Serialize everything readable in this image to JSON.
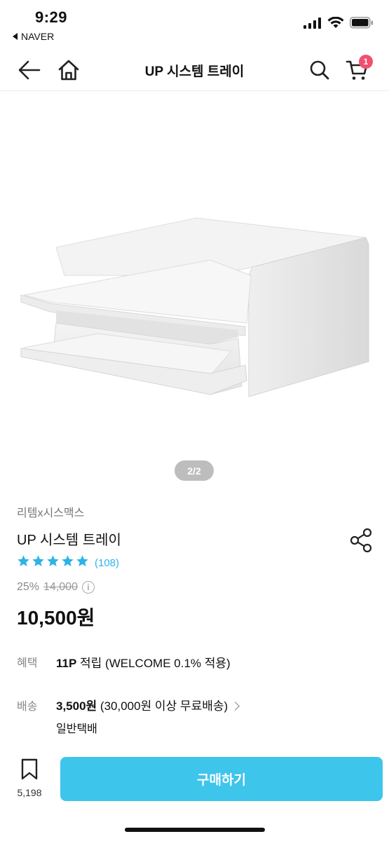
{
  "status": {
    "time": "9:29",
    "back_app": "NAVER"
  },
  "nav": {
    "title": "UP 시스템 트레이",
    "cart_count": "1"
  },
  "gallery": {
    "pager": "2/2"
  },
  "product": {
    "brand": "리템x시스맥스",
    "name": "UP 시스템 트레이",
    "rating_stars": 5,
    "review_count": "(108)",
    "discount": "25%",
    "original_price": "14,000",
    "sale_price": "10,500원"
  },
  "benefit": {
    "label": "혜택",
    "points": "11P",
    "text": " 적립 (WELCOME 0.1% 적용)"
  },
  "shipping": {
    "label": "배송",
    "fee": "3,500원",
    "text": " (30,000원 이상 무료배송)",
    "method": "일반택배"
  },
  "bottom": {
    "wish_count": "5,198",
    "buy_label": "구매하기"
  },
  "colors": {
    "accent": "#3ec5ec",
    "star": "#2fb3e6",
    "badge": "#f0506e"
  }
}
